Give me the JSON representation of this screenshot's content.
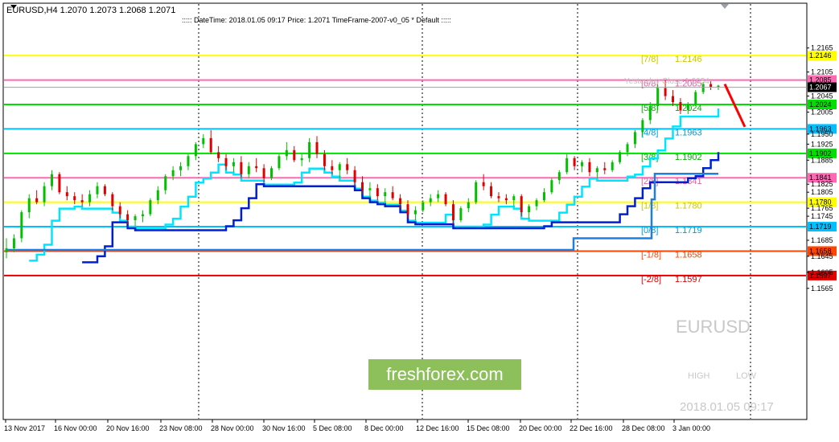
{
  "header": {
    "symbol_line": "EURUSD,H4  1.2070 1.2073 1.2068 1.2071",
    "info_line": ":::::  DateTime: 2018.01.05 09:17    Price: 1.2071    TimeFrame-2007-v0_05    *   Default  :::::"
  },
  "watermark": {
    "symbol": "EURUSD",
    "brand": "freshforex.com",
    "high_label": "HIGH",
    "low_label": "LOW",
    "datetime": "2018.01.05 09:17"
  },
  "yesterday_close_label": "Yesterday Close 1.2054",
  "colors": {
    "bull_candle": "#00c000",
    "bear_candle": "#e00000",
    "cyan_line": "#00e5ff",
    "blue_line": "#0020d0",
    "magenta_line": "#e020e0",
    "projection_blue": "#1f7fe0",
    "forecast_red": "#ff0000"
  },
  "chart_data": {
    "type": "candlestick",
    "symbol": "EURUSD",
    "timeframe": "H4",
    "ylim": [
      1.1555,
      1.2165
    ],
    "y_ticks": [
      "1.2165",
      "1.2105",
      "1.2045",
      "1.2005",
      "1.1950",
      "1.1925",
      "1.1885",
      "1.1825",
      "1.1805",
      "1.1765",
      "1.1745",
      "1.1685",
      "1.1645",
      "1.1605",
      "1.1565"
    ],
    "x_ticks": [
      "13 Nov 2017",
      "16 Nov 00:00",
      "20 Nov 16:00",
      "23 Nov 08:00",
      "28 Nov 00:00",
      "30 Nov 16:00",
      "5 Dec 08:00",
      "8 Dec 00:00",
      "12 Dec 16:00",
      "15 Dec 08:00",
      "20 Dec 00:00",
      "22 Dec 16:00",
      "28 Dec 08:00",
      "3 Jan 00:00"
    ],
    "current_price": 1.2067,
    "murrey_levels": [
      {
        "label": "[7/8]",
        "value": "1.2146",
        "color": "#ffff00",
        "text_color": "#c8c800"
      },
      {
        "label": "[6/8]",
        "value": "1.2085",
        "color": "#ff69b4",
        "text_color": "#e060a0"
      },
      {
        "label": "[5/8]",
        "value": "1.2024",
        "color": "#00e000",
        "text_color": "#00b000"
      },
      {
        "label": "[4/8]",
        "value": "1.1963",
        "color": "#00bfff",
        "text_color": "#0099dd"
      },
      {
        "label": "[3/8]",
        "value": "1.1902",
        "color": "#00e000",
        "text_color": "#00b000"
      },
      {
        "label": "[2/8]",
        "value": "1.1841",
        "color": "#ff69b4",
        "text_color": "#e060a0"
      },
      {
        "label": "[1/8]",
        "value": "1.1780",
        "color": "#ffff00",
        "text_color": "#c8c800"
      },
      {
        "label": "[0/8]",
        "value": "1.1719",
        "color": "#00bfff",
        "text_color": "#0099dd"
      },
      {
        "label": "[-1/8]",
        "value": "1.1658",
        "color": "#ff4500",
        "text_color": "#ff4500"
      },
      {
        "label": "[-2/8]",
        "value": "1.1597",
        "color": "#e00000",
        "text_color": "#e00000"
      }
    ],
    "candles": [
      [
        1.1655,
        1.169,
        1.164,
        1.1665
      ],
      [
        1.1665,
        1.17,
        1.1655,
        1.169
      ],
      [
        1.169,
        1.176,
        1.168,
        1.1755
      ],
      [
        1.1755,
        1.18,
        1.174,
        1.179
      ],
      [
        1.179,
        1.181,
        1.1775,
        1.178
      ],
      [
        1.178,
        1.183,
        1.177,
        1.182
      ],
      [
        1.182,
        1.186,
        1.181,
        1.185
      ],
      [
        1.185,
        1.1855,
        1.18,
        1.1805
      ],
      [
        1.1805,
        1.182,
        1.1785,
        1.1795
      ],
      [
        1.1795,
        1.1805,
        1.1775,
        1.1785
      ],
      [
        1.1785,
        1.18,
        1.177,
        1.178
      ],
      [
        1.178,
        1.181,
        1.177,
        1.18
      ],
      [
        1.18,
        1.183,
        1.179,
        1.182
      ],
      [
        1.182,
        1.1825,
        1.1795,
        1.18
      ],
      [
        1.18,
        1.1805,
        1.176,
        1.177
      ],
      [
        1.177,
        1.178,
        1.174,
        1.175
      ],
      [
        1.175,
        1.176,
        1.1725,
        1.1735
      ],
      [
        1.1735,
        1.175,
        1.172,
        1.1745
      ],
      [
        1.1745,
        1.176,
        1.173,
        1.175
      ],
      [
        1.175,
        1.179,
        1.1745,
        1.1785
      ],
      [
        1.1785,
        1.182,
        1.1775,
        1.181
      ],
      [
        1.181,
        1.185,
        1.18,
        1.1845
      ],
      [
        1.1845,
        1.187,
        1.1835,
        1.186
      ],
      [
        1.186,
        1.188,
        1.1845,
        1.187
      ],
      [
        1.187,
        1.19,
        1.186,
        1.1895
      ],
      [
        1.1895,
        1.193,
        1.1885,
        1.1925
      ],
      [
        1.1925,
        1.195,
        1.1915,
        1.194
      ],
      [
        1.194,
        1.196,
        1.19,
        1.1905
      ],
      [
        1.1905,
        1.192,
        1.188,
        1.189
      ],
      [
        1.189,
        1.19,
        1.186,
        1.187
      ],
      [
        1.187,
        1.189,
        1.1855,
        1.188
      ],
      [
        1.188,
        1.1895,
        1.184,
        1.185
      ],
      [
        1.185,
        1.188,
        1.184,
        1.187
      ],
      [
        1.187,
        1.189,
        1.1855,
        1.1865
      ],
      [
        1.1865,
        1.1875,
        1.183,
        1.184
      ],
      [
        1.184,
        1.187,
        1.1835,
        1.1865
      ],
      [
        1.1865,
        1.19,
        1.186,
        1.1895
      ],
      [
        1.1895,
        1.193,
        1.1885,
        1.191
      ],
      [
        1.191,
        1.192,
        1.188,
        1.1885
      ],
      [
        1.1885,
        1.19,
        1.187,
        1.189
      ],
      [
        1.189,
        1.194,
        1.188,
        1.193
      ],
      [
        1.193,
        1.1945,
        1.189,
        1.19
      ],
      [
        1.19,
        1.191,
        1.186,
        1.187
      ],
      [
        1.187,
        1.1885,
        1.185,
        1.186
      ],
      [
        1.186,
        1.188,
        1.184,
        1.1875
      ],
      [
        1.1875,
        1.189,
        1.185,
        1.186
      ],
      [
        1.186,
        1.187,
        1.182,
        1.183
      ],
      [
        1.183,
        1.1845,
        1.18,
        1.181
      ],
      [
        1.181,
        1.183,
        1.179,
        1.1815
      ],
      [
        1.1815,
        1.1825,
        1.1785,
        1.1795
      ],
      [
        1.1795,
        1.1815,
        1.178,
        1.1805
      ],
      [
        1.1805,
        1.182,
        1.1785,
        1.179
      ],
      [
        1.179,
        1.18,
        1.1765,
        1.1775
      ],
      [
        1.1775,
        1.1785,
        1.174,
        1.175
      ],
      [
        1.175,
        1.177,
        1.1735,
        1.176
      ],
      [
        1.176,
        1.1785,
        1.1755,
        1.178
      ],
      [
        1.178,
        1.18,
        1.177,
        1.179
      ],
      [
        1.179,
        1.181,
        1.178,
        1.18
      ],
      [
        1.18,
        1.1805,
        1.177,
        1.1775
      ],
      [
        1.1775,
        1.1785,
        1.1725,
        1.1735
      ],
      [
        1.1735,
        1.177,
        1.173,
        1.1765
      ],
      [
        1.1765,
        1.179,
        1.1755,
        1.178
      ],
      [
        1.178,
        1.1835,
        1.1775,
        1.183
      ],
      [
        1.183,
        1.185,
        1.181,
        1.182
      ],
      [
        1.182,
        1.183,
        1.179,
        1.1795
      ],
      [
        1.1795,
        1.1805,
        1.178,
        1.179
      ],
      [
        1.179,
        1.18,
        1.1775,
        1.1785
      ],
      [
        1.1785,
        1.18,
        1.177,
        1.1795
      ],
      [
        1.1795,
        1.18,
        1.1745,
        1.1755
      ],
      [
        1.1755,
        1.1775,
        1.174,
        1.177
      ],
      [
        1.177,
        1.179,
        1.176,
        1.1785
      ],
      [
        1.1785,
        1.1815,
        1.178,
        1.1805
      ],
      [
        1.1805,
        1.184,
        1.18,
        1.1835
      ],
      [
        1.1835,
        1.186,
        1.1825,
        1.1855
      ],
      [
        1.1855,
        1.19,
        1.185,
        1.189
      ],
      [
        1.189,
        1.1895,
        1.186,
        1.187
      ],
      [
        1.187,
        1.1885,
        1.1855,
        1.188
      ],
      [
        1.188,
        1.189,
        1.1845,
        1.1855
      ],
      [
        1.1855,
        1.187,
        1.184,
        1.1865
      ],
      [
        1.1865,
        1.188,
        1.185,
        1.186
      ],
      [
        1.186,
        1.1885,
        1.1855,
        1.188
      ],
      [
        1.188,
        1.191,
        1.1875,
        1.1905
      ],
      [
        1.1905,
        1.193,
        1.1895,
        1.1925
      ],
      [
        1.1925,
        1.196,
        1.1915,
        1.1955
      ],
      [
        1.1955,
        1.199,
        1.1945,
        1.1985
      ],
      [
        1.1985,
        1.203,
        1.1975,
        1.202
      ],
      [
        1.202,
        1.2075,
        1.201,
        1.2065
      ],
      [
        1.2065,
        1.2085,
        1.2035,
        1.2045
      ],
      [
        1.2045,
        1.206,
        1.202,
        1.203
      ],
      [
        1.203,
        1.204,
        1.2,
        1.201
      ],
      [
        1.201,
        1.203,
        1.2,
        1.2025
      ],
      [
        1.2025,
        1.206,
        1.202,
        1.2055
      ],
      [
        1.2055,
        1.208,
        1.205,
        1.2075
      ],
      [
        1.2075,
        1.2082,
        1.206,
        1.2068
      ],
      [
        1.2068,
        1.2073,
        1.206,
        1.2071
      ]
    ],
    "forecast_line": {
      "from_price": 1.2075,
      "to_price": 1.1968
    }
  }
}
